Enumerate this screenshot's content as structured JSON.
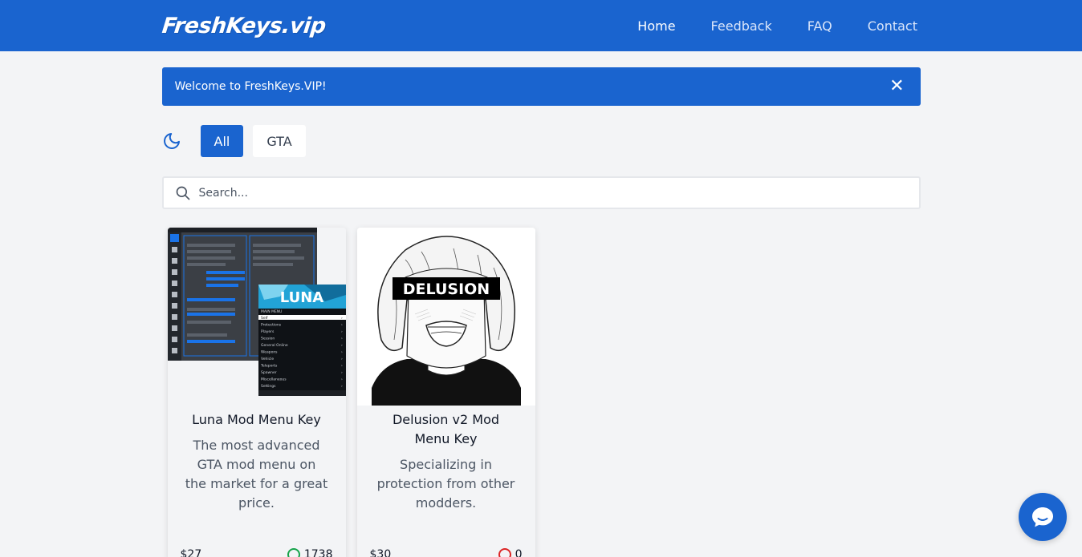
{
  "brand": {
    "logo": "FreshKeys.vip"
  },
  "nav": [
    {
      "label": "Home",
      "active": true
    },
    {
      "label": "Feedback"
    },
    {
      "label": "FAQ"
    },
    {
      "label": "Contact"
    }
  ],
  "alert": {
    "text": "Welcome to FreshKeys.VIP!",
    "close": "✕"
  },
  "filters": [
    {
      "label": "All",
      "selected": true
    },
    {
      "label": "GTA"
    }
  ],
  "search": {
    "placeholder": "Search..."
  },
  "products": [
    {
      "title": "Luna Mod Menu Key",
      "description": "The most advanced GTA mod menu on the market for a great price.",
      "price": "$27",
      "count": "1738",
      "status": "green"
    },
    {
      "title": "Delusion v2 Mod Menu Key",
      "description": "Specializing in protection from other modders.",
      "price": "$30",
      "count": "0",
      "status": "red",
      "image_text": "DELUSION"
    }
  ],
  "luna_image": {
    "badge": "LUNA",
    "menu_title": "MAIN MENU",
    "menu_items": [
      "Self",
      "Protections",
      "Players",
      "Session",
      "General Online",
      "Weapons",
      "Vehicle",
      "Teleports",
      "Spawner",
      "Miscellaneous",
      "Settings"
    ]
  },
  "colors": {
    "primary": "#1a64cf",
    "background": "#f3f4f6"
  }
}
